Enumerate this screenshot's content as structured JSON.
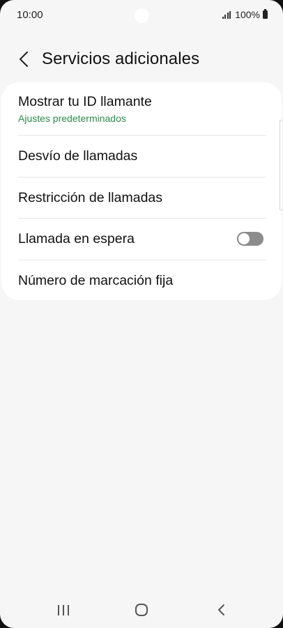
{
  "status_bar": {
    "time": "10:00",
    "battery": "100%"
  },
  "header": {
    "title": "Servicios adicionales"
  },
  "settings": [
    {
      "label": "Mostrar tu ID llamante",
      "sub": "Ajustes predeterminados"
    },
    {
      "label": "Desvío de llamadas"
    },
    {
      "label": "Restricción de llamadas"
    },
    {
      "label": "Llamada en espera",
      "toggle": false
    },
    {
      "label": "Número de marcación fija"
    }
  ],
  "colors": {
    "background": "#f6f6f6",
    "card": "#ffffff",
    "subtitle_accent": "#2a8c4a",
    "toggle_off": "#8c8c8c"
  },
  "icons": {
    "back": "chevron-left-icon",
    "signal": "signal-icon",
    "battery": "battery-icon",
    "nav_recents": "recents-icon",
    "nav_home": "home-icon",
    "nav_back": "back-icon"
  }
}
